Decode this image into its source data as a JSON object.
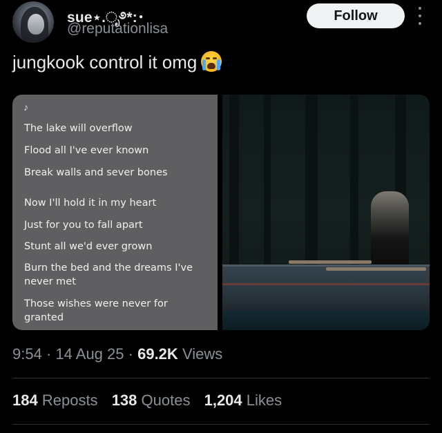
{
  "header": {
    "display_name": "sue⋆.ೃ࿔*:･",
    "handle": "@reputationlisa",
    "follow_label": "Follow"
  },
  "tweet": {
    "text": "jungkook control it omg",
    "emoji": "loudly-crying-face"
  },
  "media": {
    "note_symbol": "♪",
    "lyrics": [
      "The lake will overflow",
      "Flood all I've ever known",
      "Break walls and sever bones",
      "Now I'll hold it in my heart",
      "Just for you to fall apart",
      "Stunt all we'd ever grown",
      "Burn the bed and the dreams I've never met",
      "Those wishes were never for granted"
    ]
  },
  "meta": {
    "time": "9:54",
    "date": "14 Aug 25",
    "views_count": "69.2K",
    "views_label": "Views",
    "separator": "·"
  },
  "stats": {
    "reposts_count": "184",
    "reposts_label": "Reposts",
    "quotes_count": "138",
    "quotes_label": "Quotes",
    "likes_count": "1,204",
    "likes_label": "Likes"
  },
  "colors": {
    "background": "#000000",
    "text": "#e7e9ea",
    "muted": "#8b9096",
    "follow_bg": "#eff3f4"
  }
}
